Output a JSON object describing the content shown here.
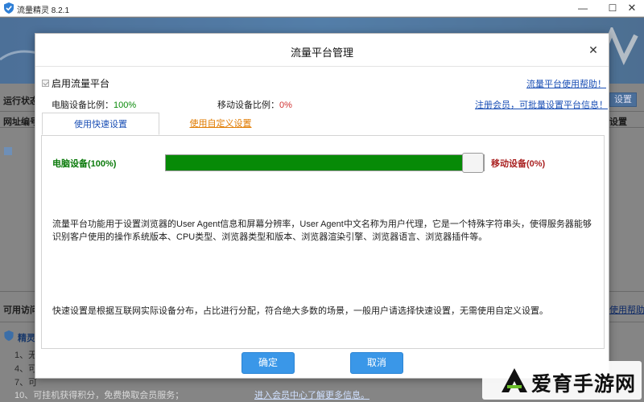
{
  "window": {
    "title": "流量精灵 8.2.1",
    "min_glyph": "—",
    "max_glyph": "☐",
    "close_glyph": "✕"
  },
  "background": {
    "run_status_label": "运行状态",
    "url_col_label": "网址编号",
    "settings_col_label": "设置",
    "setting_btn_label": "设置",
    "available_label": "可用访问",
    "usage_help_link": "使用帮助",
    "elf_panel_title": "精灵",
    "list_rows": [
      "1、无",
      "4、可",
      "7、可"
    ],
    "row_10": "10、可挂机获得积分，免费换取会员服务；",
    "member_link": "进入会员中心了解更多信息。"
  },
  "dialog": {
    "title": "流量平台管理",
    "close_glyph": "✕",
    "enable_label": "启用流量平台",
    "help_link": "流量平台使用帮助！",
    "pc_ratio_label": "电脑设备比例：",
    "pc_ratio_value": "100%",
    "mobile_ratio_label": "移动设备比例：",
    "mobile_ratio_value": "0%",
    "register_link": "注册会员，可批量设置平台信息！",
    "tabs": [
      {
        "label": "使用快速设置",
        "active": true
      },
      {
        "label": "使用自定义设置",
        "active": false
      }
    ],
    "slider": {
      "pc_label": "电脑设备(100%)",
      "mobile_label": "移动设备(0%)",
      "pc_fraction": 1.0
    },
    "desc1": "流量平台功能用于设置浏览器的User Agent信息和屏幕分辨率，User Agent中文名称为用户代理，它是一个特殊字符串头，使得服务器能够识别客户使用的操作系统版本、CPU类型、浏览器类型和版本、浏览器渲染引擎、浏览器语言、浏览器插件等。",
    "desc2": "快速设置是根据互联网实际设备分布，占比进行分配，符合绝大多数的场景，一般用户请选择快速设置，无需使用自定义设置。",
    "ok_label": "确定",
    "cancel_label": "取消"
  },
  "watermark": {
    "text": "爱育手游网"
  },
  "colors": {
    "accent_blue": "#3a97e8",
    "link_blue": "#1a4fb5",
    "slider_green": "#078a07",
    "link_orange": "#e07b00",
    "mobile_red": "#a22222"
  }
}
